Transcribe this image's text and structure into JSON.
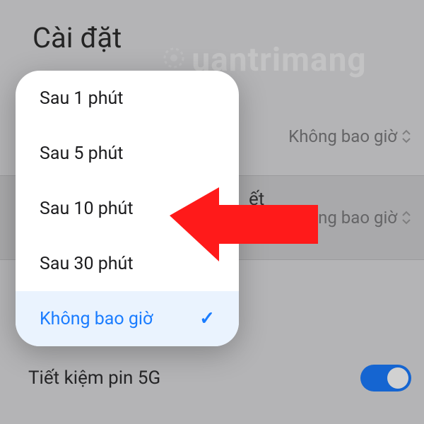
{
  "page": {
    "title": "Cài đặt"
  },
  "watermark": {
    "text": "uantrimang"
  },
  "rows": {
    "row1_value": "Không bao giờ",
    "row2_label": "ết",
    "row2_value": "Không bao giờ"
  },
  "bottom": {
    "label": "Tiết kiệm pin 5G"
  },
  "modal": {
    "items": [
      "Sau 1 phút",
      "Sau 5 phút",
      "Sau 10 phút",
      "Sau 30 phút"
    ],
    "selected": "Không bao giờ"
  }
}
